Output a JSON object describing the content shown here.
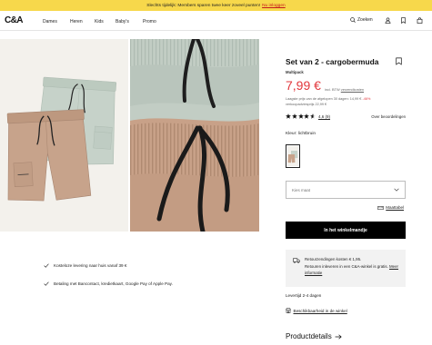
{
  "banner": {
    "text": "Slechts tijdelijk: Members sparen twee keer zoveel punten!",
    "link": "Nu inloggen"
  },
  "header": {
    "logo": "C&A",
    "nav": [
      "Dames",
      "Heren",
      "Kids",
      "Baby's",
      "Promo"
    ],
    "search_label": "Zoeken",
    "icons": [
      "search-icon",
      "user-icon",
      "bookmark-icon",
      "bag-icon"
    ]
  },
  "product": {
    "title": "Set van 2 - cargobermuda",
    "subtitle": "Multipack",
    "price": "7,99 €",
    "tax_note": "incl. BTW",
    "shipping_link": "verzendkosten",
    "lowest_price": "Laagste prijs van de afgelopen 30 dagen: 14,99 €",
    "discount": "-46%",
    "advice_price": "verkoopadviesprijs 22,99 €",
    "rating": {
      "score": 4.6,
      "label": "4,6 (9)"
    },
    "reviews_link": "Over beoordelingen",
    "color_label": "Kleur: lichtbruin",
    "size_select": {
      "placeholder": "Kies maat"
    },
    "size_chart_link": "Maattabel",
    "add_to_cart": "In het winkelmandje",
    "returns": {
      "line1": "Retourzendingen kosten € 1,95.",
      "text": "Retouren inleveren in een C&A-winkel is gratis.",
      "link": "Meer informatie"
    },
    "delivery": "Levertijd 2-4 dagen",
    "store_availability": "Beschikbaarheid in de winkel",
    "details": "Productdetails"
  },
  "benefits": [
    "Kosteloze levering naar huis vanaf 39 €",
    "Betaling met Bancontact, kredietkaart, Google Pay of Apple Pay."
  ],
  "colors": {
    "banner": "#f7d84b",
    "price": "#e2383d",
    "button": "#000000",
    "panel": "#f2f2f2"
  }
}
